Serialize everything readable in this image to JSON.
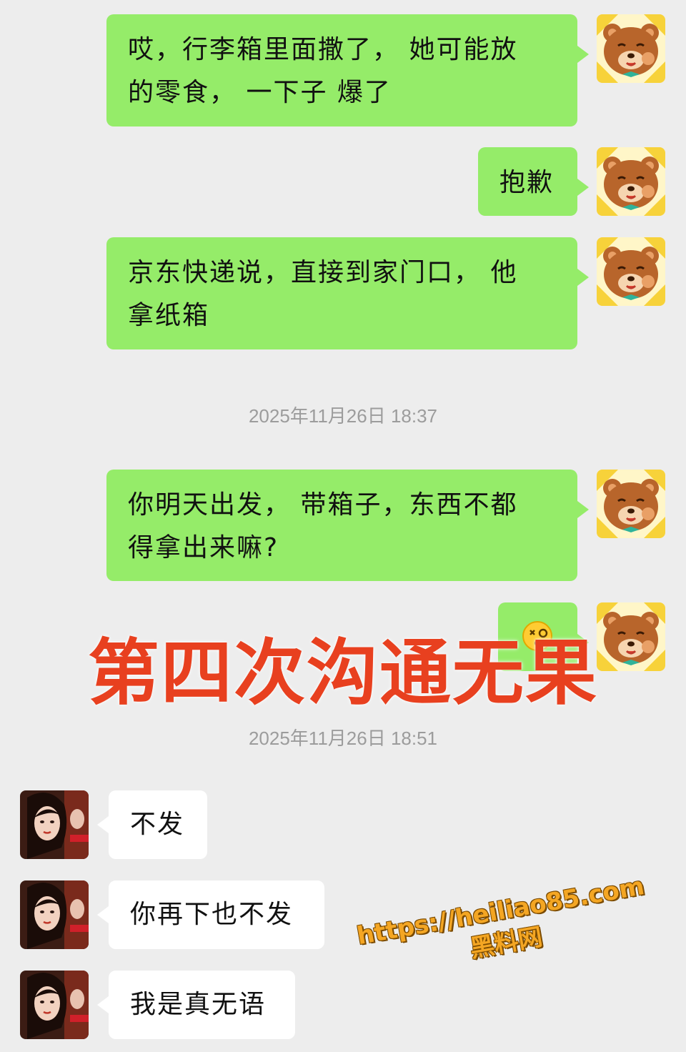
{
  "messages": [
    {
      "side": "out",
      "text": "哎，行李箱里面撒了， 她可能放的零食， 一下子 爆了",
      "avatar": "bear-avatar"
    },
    {
      "side": "out",
      "text": "抱歉",
      "avatar": "bear-avatar"
    },
    {
      "side": "out",
      "text": "京东快递说，直接到家门口， 他拿纸箱",
      "avatar": "bear-avatar"
    },
    {
      "side": "out",
      "text": "你明天出发， 带箱子，东西不都得拿出来嘛?",
      "avatar": "bear-avatar"
    },
    {
      "side": "out",
      "text": "",
      "avatar": "bear-avatar",
      "sticker": "dizzy-face-emoji"
    },
    {
      "side": "in",
      "text": "不发",
      "avatar": "woman-portrait-avatar"
    },
    {
      "side": "in",
      "text": "你再下也不发",
      "avatar": "woman-portrait-avatar"
    },
    {
      "side": "in",
      "text": "我是真无语",
      "avatar": "woman-portrait-avatar"
    }
  ],
  "msg1_line1": "哎，行李箱里面撒了， 她可能放",
  "msg1_line2": "的零食， 一下子 爆了",
  "msg2": "抱歉",
  "msg3_line1": "京东快递说，直接到家门口， 他",
  "msg3_line2": "拿纸箱",
  "msg4_line1": "你明天出发， 带箱子，东西不都",
  "msg4_line2": "得拿出来嘛?",
  "msg6": "不发",
  "msg7": "你再下也不发",
  "msg8": "我是真无语",
  "timestamps": [
    "2025年11月26日 18:37",
    "2025年11月26日 18:51"
  ],
  "overlay_caption": "第四次沟通无果",
  "watermark": {
    "url": "https://heiliao85.com",
    "site": "黑料网"
  },
  "colors": {
    "background": "#ededed",
    "outgoing_bubble": "#95ec69",
    "incoming_bubble": "#ffffff",
    "caption": "#e8401f",
    "watermark": "#f4a623",
    "timestamp": "#9c9c9c"
  }
}
